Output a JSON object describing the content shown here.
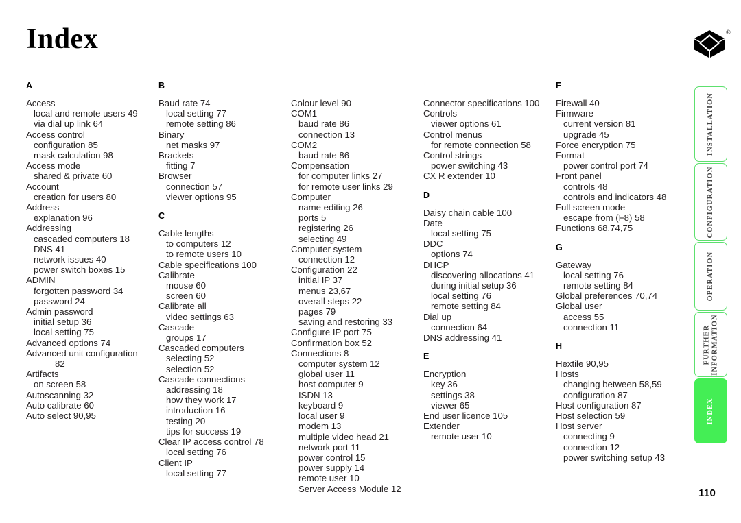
{
  "page": {
    "title": "Index",
    "number": "110",
    "logo_mark": "diamond-logo",
    "registered_mark": "®",
    "accent_color": "#44ee55",
    "tab_border_color": "#5de06e"
  },
  "tabs": [
    {
      "label": "INSTALLATION",
      "active": false
    },
    {
      "label": "CONFIGURATION",
      "active": false
    },
    {
      "label": "OPERATION",
      "active": false
    },
    {
      "label": "FURTHER\nINFORMATION",
      "active": false
    },
    {
      "label": "INDEX",
      "active": true
    }
  ],
  "columns": [
    {
      "id": "column-1",
      "blocks": [
        {
          "letter": "A",
          "entries": [
            {
              "text": "Access",
              "level": 0
            },
            {
              "text": "local and remote users  49",
              "level": 1
            },
            {
              "text": "via dial up link  64",
              "level": 1
            },
            {
              "text": "Access control",
              "level": 0
            },
            {
              "text": "configuration  85",
              "level": 1
            },
            {
              "text": "mask calculation  98",
              "level": 1
            },
            {
              "text": "Access mode",
              "level": 0
            },
            {
              "text": "shared & private  60",
              "level": 1
            },
            {
              "text": "Account",
              "level": 0
            },
            {
              "text": "creation for users  80",
              "level": 1
            },
            {
              "text": "Address",
              "level": 0
            },
            {
              "text": "explanation  96",
              "level": 1
            },
            {
              "text": "Addressing",
              "level": 0
            },
            {
              "text": "cascaded computers  18",
              "level": 1
            },
            {
              "text": "DNS  41",
              "level": 1
            },
            {
              "text": "network issues  40",
              "level": 1
            },
            {
              "text": "power switch boxes  15",
              "level": 1
            },
            {
              "text": "ADMIN",
              "level": 0
            },
            {
              "text": "forgotten password  34",
              "level": 1
            },
            {
              "text": "password  24",
              "level": 1
            },
            {
              "text": "Admin password",
              "level": 0
            },
            {
              "text": "initial setup  36",
              "level": 1
            },
            {
              "text": "local setting  75",
              "level": 1
            },
            {
              "text": "Advanced options  74",
              "level": 0
            },
            {
              "text": "Advanced unit configuration",
              "level": 0
            },
            {
              "text": "82",
              "level": 2
            },
            {
              "text": "Artifacts",
              "level": 0
            },
            {
              "text": "on screen  58",
              "level": 1
            },
            {
              "text": "Autoscanning  32",
              "level": 0
            },
            {
              "text": "Auto calibrate  60",
              "level": 0
            },
            {
              "text": "Auto select  90,95",
              "level": 0
            }
          ]
        }
      ]
    },
    {
      "id": "column-2",
      "blocks": [
        {
          "letter": "B",
          "entries": [
            {
              "text": "Baud rate  74",
              "level": 0
            },
            {
              "text": "local setting  77",
              "level": 1
            },
            {
              "text": "remote setting  86",
              "level": 1
            },
            {
              "text": "Binary",
              "level": 0
            },
            {
              "text": "net masks  97",
              "level": 1
            },
            {
              "text": "Brackets",
              "level": 0
            },
            {
              "text": "fitting  7",
              "level": 1
            },
            {
              "text": "Browser",
              "level": 0
            },
            {
              "text": "connection  57",
              "level": 1
            },
            {
              "text": "viewer options  95",
              "level": 1
            }
          ]
        },
        {
          "letter": "C",
          "spaced": true,
          "entries": [
            {
              "text": "Cable lengths",
              "level": 0
            },
            {
              "text": "to computers  12",
              "level": 1
            },
            {
              "text": "to remote users  10",
              "level": 1
            },
            {
              "text": "Cable specifications  100",
              "level": 0
            },
            {
              "text": "Calibrate",
              "level": 0
            },
            {
              "text": "mouse  60",
              "level": 1
            },
            {
              "text": "screen  60",
              "level": 1
            },
            {
              "text": "Calibrate all",
              "level": 0
            },
            {
              "text": "video settings  63",
              "level": 1
            },
            {
              "text": "Cascade",
              "level": 0
            },
            {
              "text": "groups  17",
              "level": 1
            },
            {
              "text": "Cascaded computers",
              "level": 0
            },
            {
              "text": "selecting  52",
              "level": 1
            },
            {
              "text": "selection  52",
              "level": 1
            },
            {
              "text": "Cascade connections",
              "level": 0
            },
            {
              "text": "addressing  18",
              "level": 1
            },
            {
              "text": "how they work  17",
              "level": 1
            },
            {
              "text": "introduction  16",
              "level": 1
            },
            {
              "text": "testing  20",
              "level": 1
            },
            {
              "text": "tips for success  19",
              "level": 1
            },
            {
              "text": "Clear IP access control  78",
              "level": 0
            },
            {
              "text": "local setting  76",
              "level": 1
            },
            {
              "text": "Client IP",
              "level": 0
            },
            {
              "text": "local setting  77",
              "level": 1
            }
          ]
        }
      ]
    },
    {
      "id": "column-3",
      "blocks": [
        {
          "letter": "",
          "entries": [
            {
              "text": "Colour level  90",
              "level": 0
            },
            {
              "text": "COM1",
              "level": 0
            },
            {
              "text": "baud rate  86",
              "level": 1
            },
            {
              "text": "connection  13",
              "level": 1
            },
            {
              "text": "COM2",
              "level": 0
            },
            {
              "text": "baud rate  86",
              "level": 1
            },
            {
              "text": "Compensation",
              "level": 0
            },
            {
              "text": "for computer links  27",
              "level": 1
            },
            {
              "text": "for remote user links  29",
              "level": 1
            },
            {
              "text": "Computer",
              "level": 0
            },
            {
              "text": "name editing  26",
              "level": 1
            },
            {
              "text": "ports  5",
              "level": 1
            },
            {
              "text": "registering  26",
              "level": 1
            },
            {
              "text": "selecting  49",
              "level": 1
            },
            {
              "text": "Computer system",
              "level": 0
            },
            {
              "text": "connection  12",
              "level": 1
            },
            {
              "text": "Configuration  22",
              "level": 0
            },
            {
              "text": "initial IP  37",
              "level": 1
            },
            {
              "text": "menus  23,67",
              "level": 1
            },
            {
              "text": "overall steps  22",
              "level": 1
            },
            {
              "text": "pages  79",
              "level": 1
            },
            {
              "text": "saving and restoring  33",
              "level": 1
            },
            {
              "text": "Configure IP port  75",
              "level": 0
            },
            {
              "text": "Confirmation box  52",
              "level": 0
            },
            {
              "text": "Connections  8",
              "level": 0
            },
            {
              "text": "computer system  12",
              "level": 1
            },
            {
              "text": "global user  11",
              "level": 1
            },
            {
              "text": "host computer  9",
              "level": 1
            },
            {
              "text": "ISDN  13",
              "level": 1
            },
            {
              "text": "keyboard  9",
              "level": 1
            },
            {
              "text": "local user  9",
              "level": 1
            },
            {
              "text": "modem  13",
              "level": 1
            },
            {
              "text": "multiple video head  21",
              "level": 1
            },
            {
              "text": "network port  11",
              "level": 1
            },
            {
              "text": "power control  15",
              "level": 1
            },
            {
              "text": "power supply  14",
              "level": 1
            },
            {
              "text": "remote user  10",
              "level": 1
            },
            {
              "text": "Server Access Module  12",
              "level": 1
            }
          ]
        }
      ]
    },
    {
      "id": "column-4",
      "blocks": [
        {
          "letter": "",
          "entries": [
            {
              "text": "Connector specifications  100",
              "level": 0
            },
            {
              "text": "Controls",
              "level": 0
            },
            {
              "text": "viewer options  61",
              "level": 1
            },
            {
              "text": "Control menus",
              "level": 0
            },
            {
              "text": "for remote connection  58",
              "level": 1
            },
            {
              "text": "Control strings",
              "level": 0
            },
            {
              "text": "power switching  43",
              "level": 1
            },
            {
              "text": "CX R extender  10",
              "level": 0
            }
          ]
        },
        {
          "letter": "D",
          "spaced": true,
          "entries": [
            {
              "text": "Daisy chain cable  100",
              "level": 0
            },
            {
              "text": "Date",
              "level": 0
            },
            {
              "text": "local setting  75",
              "level": 1
            },
            {
              "text": "DDC",
              "level": 0
            },
            {
              "text": "options  74",
              "level": 1
            },
            {
              "text": "DHCP",
              "level": 0
            },
            {
              "text": "discovering allocations  41",
              "level": 1
            },
            {
              "text": "during initial setup  36",
              "level": 1
            },
            {
              "text": "local setting  76",
              "level": 1
            },
            {
              "text": "remote setting  84",
              "level": 1
            },
            {
              "text": "Dial up",
              "level": 0
            },
            {
              "text": "connection  64",
              "level": 1
            },
            {
              "text": "DNS addressing  41",
              "level": 0
            }
          ]
        },
        {
          "letter": "E",
          "spaced": true,
          "entries": [
            {
              "text": "Encryption",
              "level": 0
            },
            {
              "text": "key  36",
              "level": 1
            },
            {
              "text": "settings  38",
              "level": 1
            },
            {
              "text": "viewer  65",
              "level": 1
            },
            {
              "text": "End user licence  105",
              "level": 0
            },
            {
              "text": "Extender",
              "level": 0
            },
            {
              "text": "remote user  10",
              "level": 1
            }
          ]
        }
      ]
    },
    {
      "id": "column-5",
      "blocks": [
        {
          "letter": "F",
          "entries": [
            {
              "text": "Firewall  40",
              "level": 0
            },
            {
              "text": "Firmware",
              "level": 0
            },
            {
              "text": "current version  81",
              "level": 1
            },
            {
              "text": "upgrade  45",
              "level": 1
            },
            {
              "text": "Force encryption  75",
              "level": 0
            },
            {
              "text": "Format",
              "level": 0
            },
            {
              "text": "power control port  74",
              "level": 1
            },
            {
              "text": "Front panel",
              "level": 0
            },
            {
              "text": "controls  48",
              "level": 1
            },
            {
              "text": "controls and indicators  48",
              "level": 1
            },
            {
              "text": "Full screen mode",
              "level": 0
            },
            {
              "text": "escape from (F8)  58",
              "level": 1
            },
            {
              "text": "Functions  68,74,75",
              "level": 0
            }
          ]
        },
        {
          "letter": "G",
          "spaced": true,
          "entries": [
            {
              "text": "Gateway",
              "level": 0
            },
            {
              "text": "local setting  76",
              "level": 1
            },
            {
              "text": "remote setting  84",
              "level": 1
            },
            {
              "text": "Global preferences  70,74",
              "level": 0
            },
            {
              "text": "Global user",
              "level": 0
            },
            {
              "text": "access  55",
              "level": 1
            },
            {
              "text": "connection  11",
              "level": 1
            }
          ]
        },
        {
          "letter": "H",
          "spaced": true,
          "entries": [
            {
              "text": "Hextile  90,95",
              "level": 0
            },
            {
              "text": "Hosts",
              "level": 0
            },
            {
              "text": "changing between  58,59",
              "level": 1
            },
            {
              "text": "configuration  87",
              "level": 1
            },
            {
              "text": "Host configuration  87",
              "level": 0
            },
            {
              "text": "Host selection  59",
              "level": 0
            },
            {
              "text": "Host server",
              "level": 0
            },
            {
              "text": "connecting  9",
              "level": 1
            },
            {
              "text": "connection  12",
              "level": 1
            },
            {
              "text": "power switching setup  43",
              "level": 1
            }
          ]
        }
      ]
    }
  ]
}
